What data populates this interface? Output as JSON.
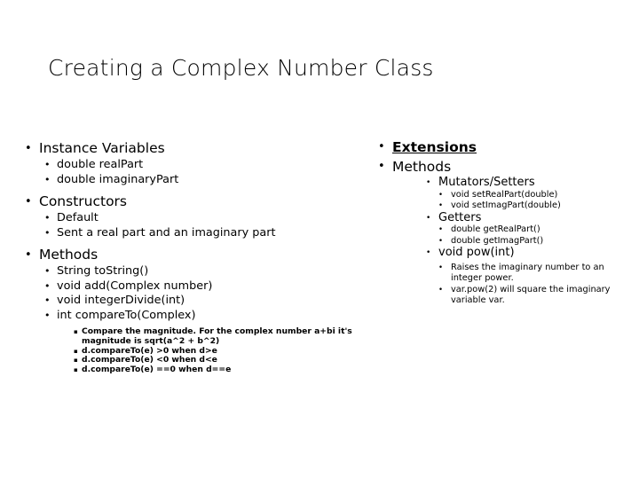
{
  "slide": {
    "title": "Creating a Complex Number Class",
    "background_color": "#ffffff",
    "text_color": "#000000"
  },
  "left_column": {
    "sections": [
      {
        "heading": "Instance Variables",
        "items": [
          "double realPart",
          "double imaginaryPart"
        ]
      },
      {
        "heading": "Constructors",
        "items": [
          "Default",
          "Sent a real part and an imaginary part"
        ]
      },
      {
        "heading": "Methods",
        "items": [
          "String toString()",
          "void add(Complex number)",
          "void integerDivide(int)",
          "int compareTo(Complex)"
        ],
        "notes": [
          "Compare the magnitude.  For the complex number a+bi it's magnitude is sqrt(a^2 + b^2)",
          "d.compareTo(e) >0 when d>e",
          "d.compareTo(e) <0 when d<e",
          "d.compareTo(e) ==0 when d==e"
        ]
      }
    ]
  },
  "right_column": {
    "title": "Extensions",
    "heading": "Methods",
    "groups": [
      {
        "name": "Mutators/Setters",
        "items": [
          {
            "label": "void setRealPart(double)",
            "details": []
          },
          {
            "label": "void setImagPart(double)",
            "details": []
          }
        ]
      },
      {
        "name": "Getters",
        "items": [
          {
            "label": "double getRealPart()",
            "details": []
          },
          {
            "label": "double getImagPart()",
            "details": []
          }
        ]
      },
      {
        "name": "void pow(int)",
        "items": [],
        "details": [
          "Raises the imaginary number to an integer power.",
          "var.pow(2) will square the imaginary variable var."
        ]
      }
    ]
  },
  "bullets": {
    "round": "•",
    "square": "▪"
  }
}
